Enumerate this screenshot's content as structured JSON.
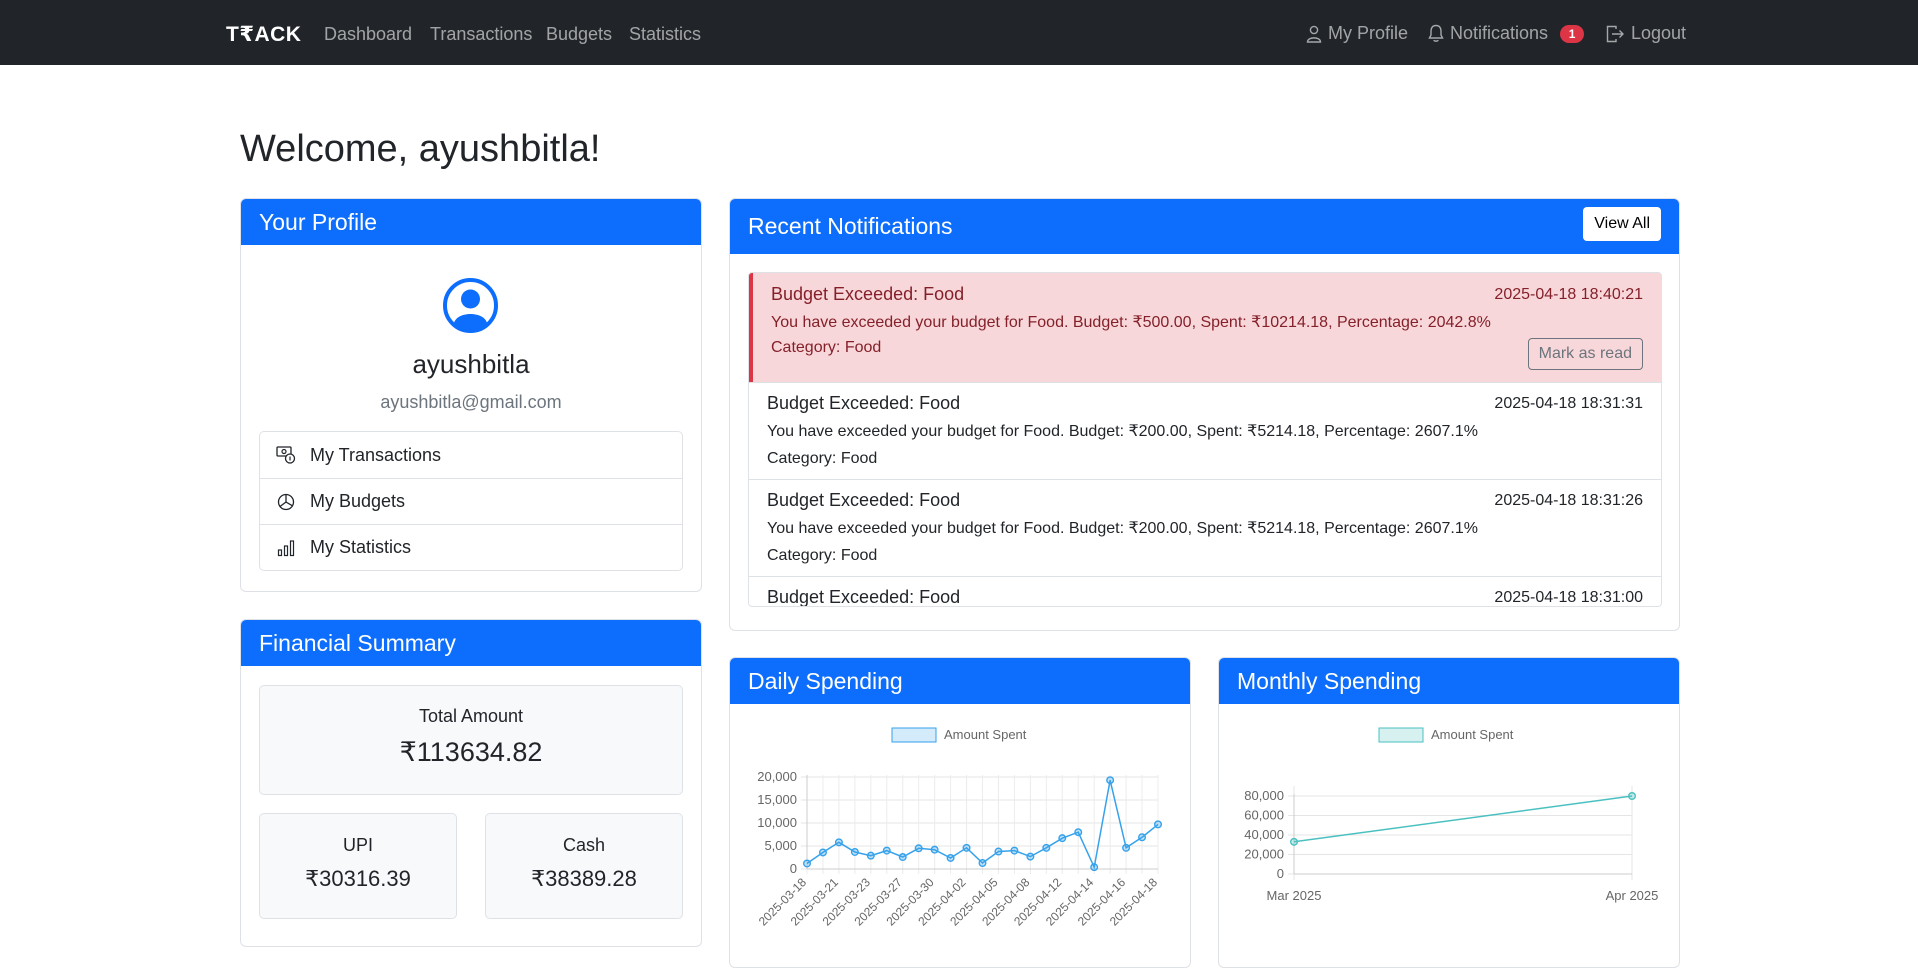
{
  "navbar": {
    "brand": "T₹ACK",
    "links": [
      "Dashboard",
      "Transactions",
      "Budgets",
      "Statistics"
    ],
    "profile": "My Profile",
    "notifications": "Notifications",
    "notifications_count": "1",
    "logout": "Logout"
  },
  "welcome": "Welcome, ayushbitla!",
  "profile": {
    "header": "Your Profile",
    "username": "ayushbitla",
    "email": "ayushbitla@gmail.com",
    "links": [
      {
        "label": "My Transactions",
        "icon": "cash-coin-icon"
      },
      {
        "label": "My Budgets",
        "icon": "pie-chart-icon"
      },
      {
        "label": "My Statistics",
        "icon": "bar-chart-icon"
      }
    ]
  },
  "summary": {
    "header": "Financial Summary",
    "total_label": "Total Amount",
    "total_value": "₹113634.82",
    "upi_label": "UPI",
    "upi_value": "₹30316.39",
    "cash_label": "Cash",
    "cash_value": "₹38389.28"
  },
  "notifications": {
    "header": "Recent Notifications",
    "view_all": "View All",
    "mark_read": "Mark as read",
    "items": [
      {
        "title": "Budget Exceeded: Food",
        "time": "2025-04-18 18:40:21",
        "message": "You have exceeded your budget for Food. Budget: ₹500.00, Spent: ₹10214.18, Percentage: 2042.8%",
        "category": "Category: Food",
        "unread": true
      },
      {
        "title": "Budget Exceeded: Food",
        "time": "2025-04-18 18:31:31",
        "message": "You have exceeded your budget for Food. Budget: ₹200.00, Spent: ₹5214.18, Percentage: 2607.1%",
        "category": "Category: Food",
        "unread": false
      },
      {
        "title": "Budget Exceeded: Food",
        "time": "2025-04-18 18:31:26",
        "message": "You have exceeded your budget for Food. Budget: ₹200.00, Spent: ₹5214.18, Percentage: 2607.1%",
        "category": "Category: Food",
        "unread": false
      },
      {
        "title": "Budget Exceeded: Food",
        "time": "2025-04-18 18:31:00",
        "message": "",
        "category": "",
        "unread": false
      }
    ]
  },
  "daily_chart": {
    "header": "Daily Spending"
  },
  "monthly_chart": {
    "header": "Monthly Spending"
  },
  "chart_data": [
    {
      "type": "line",
      "legend": "Amount Spent",
      "legend_position": "top",
      "grid": true,
      "ylim": [
        0,
        20000
      ],
      "yticks": [
        "0",
        "5,000",
        "10,000",
        "15,000",
        "20,000"
      ],
      "x_tick_labels": [
        "2025-03-18",
        "2025-03-21",
        "2025-03-23",
        "2025-03-27",
        "2025-03-30",
        "2025-04-02",
        "2025-04-05",
        "2025-04-08",
        "2025-04-12",
        "2025-04-14",
        "2025-04-16",
        "2025-04-18"
      ],
      "values": [
        1200,
        3600,
        5800,
        3700,
        2900,
        4000,
        2600,
        4500,
        4200,
        2400,
        4600,
        1300,
        3800,
        4000,
        2700,
        4600,
        6700,
        8000,
        400,
        19300,
        4600,
        6900,
        9700
      ],
      "color": "#36a2eb"
    },
    {
      "type": "line",
      "legend": "Amount Spent",
      "legend_position": "top",
      "grid": true,
      "ylim": [
        0,
        80000
      ],
      "yticks": [
        "0",
        "20,000",
        "40,000",
        "60,000",
        "80,000"
      ],
      "categories": [
        "Mar 2025",
        "Apr 2025"
      ],
      "values": [
        33000,
        80000
      ],
      "color": "#4bc0c0"
    }
  ]
}
